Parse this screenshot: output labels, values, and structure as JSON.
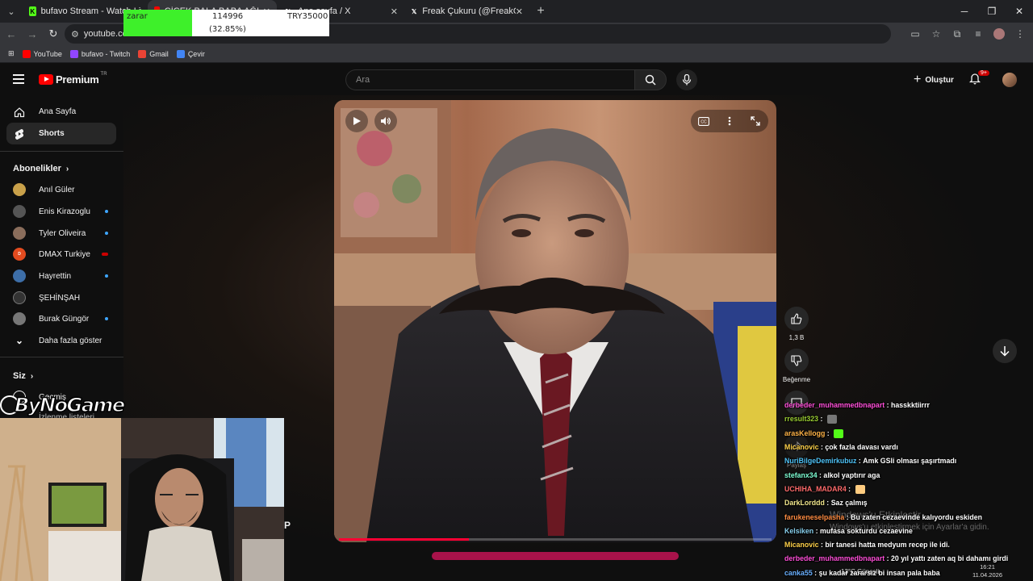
{
  "browser": {
    "tabs": [
      {
        "title": "bufavo Stream - Watch Live on Kick",
        "favicon_color": "#53fc18",
        "active": false
      },
      {
        "title": "ÇİÇEK BALA BABA AĞLADI YÜZ - YouTube",
        "favicon_color": "#ff0000",
        "active": true
      },
      {
        "title": "Ana sayfa / X",
        "favicon_color": "#000000",
        "active": false
      },
      {
        "title": "Freak Çukuru (@FreakCukuru) / X",
        "favicon_color": "#000000",
        "active": false
      }
    ],
    "url": "youtube.com/shorts/",
    "bookmarks": [
      {
        "label": "YouTube",
        "color": "#ff0000"
      },
      {
        "label": "bufavo - Twitch",
        "color": "#9146ff"
      },
      {
        "label": "Gmail",
        "color": "#ea4335"
      },
      {
        "label": "Çevir",
        "color": "#4285f4"
      }
    ]
  },
  "overlay": {
    "label": "zarar",
    "amount": "114996",
    "percent": "(32.85%)",
    "target": "TRY35000"
  },
  "youtube": {
    "logo_word": "Premium",
    "country": "TR",
    "search_placeholder": "Ara",
    "create_label": "Oluştur",
    "notif_count": "9+"
  },
  "sidebar": {
    "main": [
      {
        "label": "Ana Sayfa",
        "icon": "home-icon"
      },
      {
        "label": "Shorts",
        "icon": "shorts-icon",
        "active": true
      }
    ],
    "subs_header": "Abonelikler",
    "subs": [
      {
        "name": "Anıl Güler",
        "color": "#c9a14a",
        "live": false
      },
      {
        "name": "Enis Kirazoglu",
        "color": "#555555",
        "live": true
      },
      {
        "name": "Tyler Oliveira",
        "color": "#8a6d5b",
        "live": true
      },
      {
        "name": "DMAX Turkiye",
        "color": "#e34b1f",
        "live": true
      },
      {
        "name": "Hayrettin",
        "color": "#3d6ea8",
        "live": true
      },
      {
        "name": "ŞEHİNŞAH",
        "color": "#333333",
        "live": false
      },
      {
        "name": "Burak Güngör",
        "color": "#777777",
        "live": true
      }
    ],
    "show_more": "Daha fazla göster",
    "you_header": "Siz",
    "history": "Geçmiş",
    "watch_later": "İzlenme listeleri"
  },
  "player": {
    "progress": 0.3,
    "likes": "1,3 B",
    "dislike_label": "Beğenme",
    "share_label": "Paylaş"
  },
  "webcam": {
    "logo_text": "ByNoGame",
    "edge_letter": "P"
  },
  "chat": [
    {
      "user": "derbeder_muhammedbnapart",
      "color": "#ff4fd8",
      "text": "hasskktiirrr",
      "emote": null
    },
    {
      "user": "rresult323",
      "color": "#9acd32",
      "text": "",
      "emote": "#777777"
    },
    {
      "user": "arasKellogg",
      "color": "#ffb347",
      "text": "",
      "emote": "#53fc18"
    },
    {
      "user": "Micanovic",
      "color": "#ffd24a",
      "text": "çok fazla davası vardı",
      "emote": null
    },
    {
      "user": "NuriBilgeDemirkubuz",
      "color": "#4fc3f7",
      "text": "Amk GSli olması şaşırtmadı",
      "emote": null
    },
    {
      "user": "stefanx34",
      "color": "#7fffd4",
      "text": "alkol yaptırır aga",
      "emote": null
    },
    {
      "user": "UCHIHA_MADAR4",
      "color": "#ff6b6b",
      "text": "",
      "emote": "#ffcc80"
    },
    {
      "user": "DarkLorddd",
      "color": "#f0e68c",
      "text": "Saz çalmış",
      "emote": null
    },
    {
      "user": "farukeneselpasha",
      "color": "#ff8c42",
      "text": "Bu zaten cezaevinde kalıyordu eskiden",
      "emote": null
    },
    {
      "user": "Kelsiken",
      "color": "#87ceeb",
      "text": "mufasa sokturdu cezaevine",
      "emote": null
    },
    {
      "user": "Micanovic",
      "color": "#ffd24a",
      "text": "bir tanesi hatta medyum recep ile idi.",
      "emote": null
    },
    {
      "user": "derbeder_muhammedbnapart",
      "color": "#ff4fd8",
      "text": "20 yıl yattı zaten aq bi dahamı girdi",
      "emote": null
    },
    {
      "user": "canka55",
      "color": "#6ab0ff",
      "text": "şu kadar zararsız bi insan pala baba",
      "emote": null
    }
  ],
  "system": {
    "watermark_line1": "Windows'u Etkinleştir",
    "watermark_line2": "Windows'u etkinleştirmek için Ayarlar'a gidin.",
    "weather": "13°C  Güneşli",
    "time": "16:21",
    "date": "11.04.2026"
  }
}
